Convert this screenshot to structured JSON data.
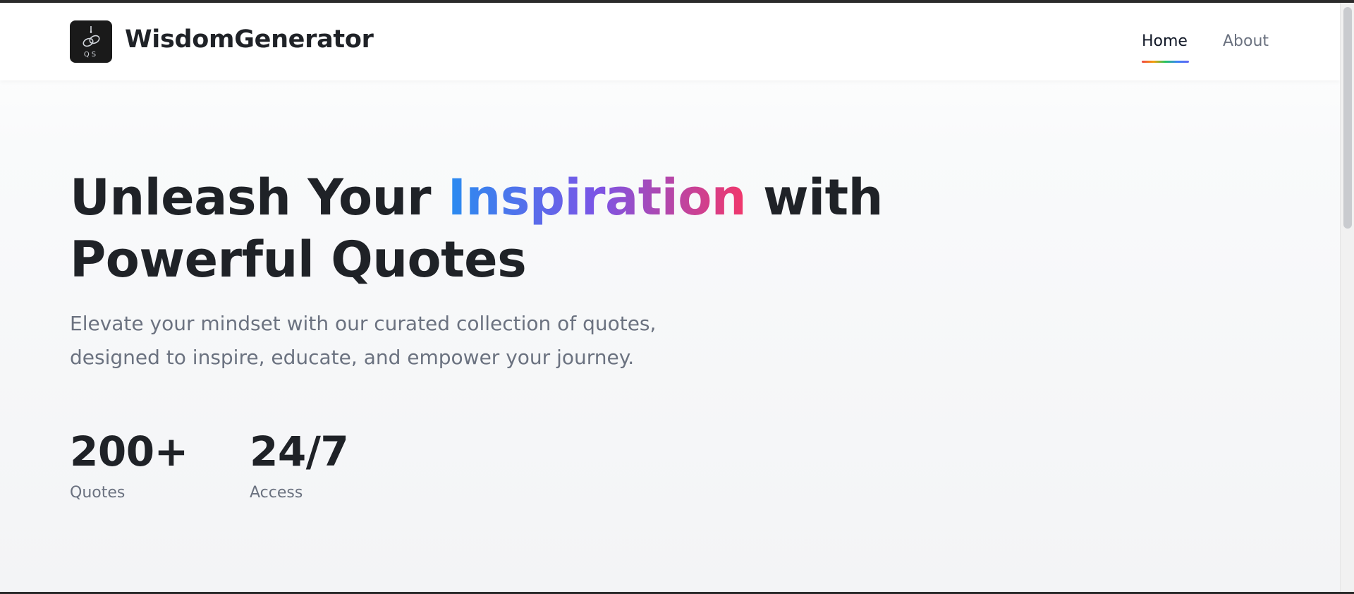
{
  "header": {
    "brand": "WisdomGenerator",
    "logo_text": "QS",
    "nav": {
      "home": "Home",
      "about": "About",
      "active": "Home"
    }
  },
  "hero": {
    "title_before": "Unleash Your ",
    "title_accent": "Inspiration",
    "title_after": " with Powerful Quotes",
    "subtitle": "Elevate your mindset with our curated collection of quotes, designed to inspire, educate, and empower your journey."
  },
  "stats": [
    {
      "value": "200+",
      "label": "Quotes"
    },
    {
      "value": "24/7",
      "label": "Access"
    }
  ],
  "colors": {
    "accent_gradient": [
      "#2a8cf0",
      "#7b55e6",
      "#f2376a"
    ],
    "nav_underline_gradient": [
      "#ef4444",
      "#f59e0b",
      "#22c55e",
      "#3b82f6",
      "#6366f1"
    ],
    "text_dark": "#1f2227",
    "text_muted": "#6b7280"
  }
}
